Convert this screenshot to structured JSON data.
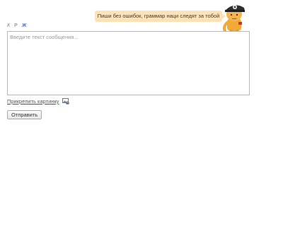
{
  "hint": {
    "text": "Пиши без ошибок, граммар наци следят за тобой"
  },
  "toolbar": {
    "items": [
      {
        "label": "К",
        "style": "italic"
      },
      {
        "label": "Р",
        "style": "regular"
      },
      {
        "label": "Ж",
        "style": "bold"
      }
    ]
  },
  "composer": {
    "placeholder": "Введите текст сообщения...",
    "value": ""
  },
  "attach": {
    "label": "Прикрепить картинку",
    "icon": "image-attach-icon"
  },
  "submit": {
    "label": "Отправить"
  },
  "colors": {
    "bubble_bg": "#fbe3b7",
    "link_blue": "#3a78c8",
    "border": "#b8b8b8"
  }
}
